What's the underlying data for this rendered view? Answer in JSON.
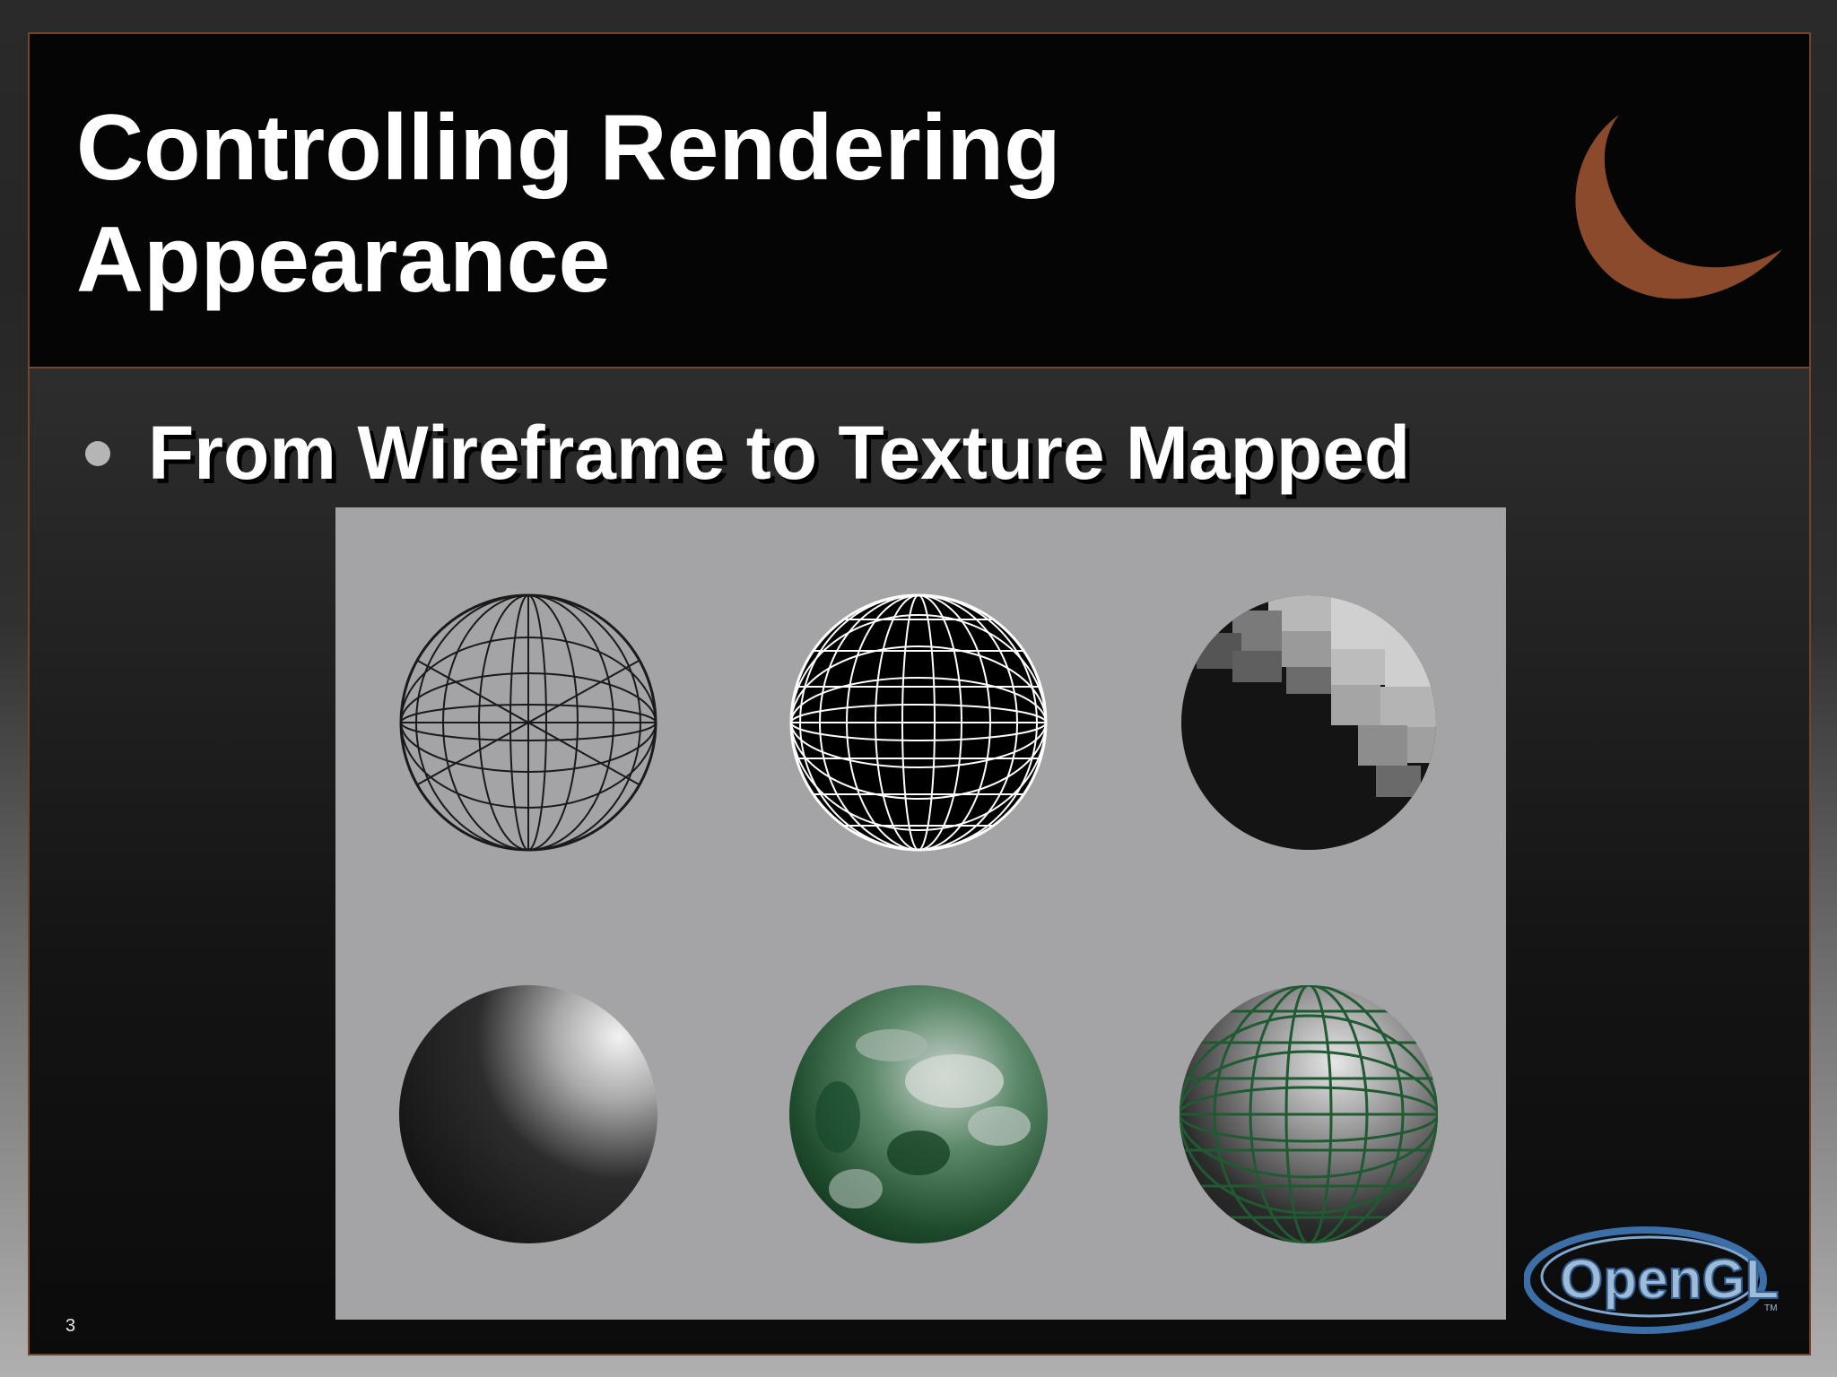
{
  "slide": {
    "title_line1": "Controlling Rendering",
    "title_line2": "Appearance",
    "bullet": "From Wireframe to Texture Mapped",
    "page_number": "3",
    "logo_text": "OpenGL",
    "logo_tm": "TM"
  },
  "figure": {
    "spheres": [
      "wireframe-sphere",
      "wireframe-on-black-sphere",
      "flat-shaded-sphere",
      "smooth-shaded-sphere",
      "texture-mapped-sphere",
      "texture-mapped-grid-sphere"
    ]
  },
  "colors": {
    "accent": "#8b4a2b",
    "title_bar": "#050505",
    "figure_bg": "#a4a3a5"
  }
}
